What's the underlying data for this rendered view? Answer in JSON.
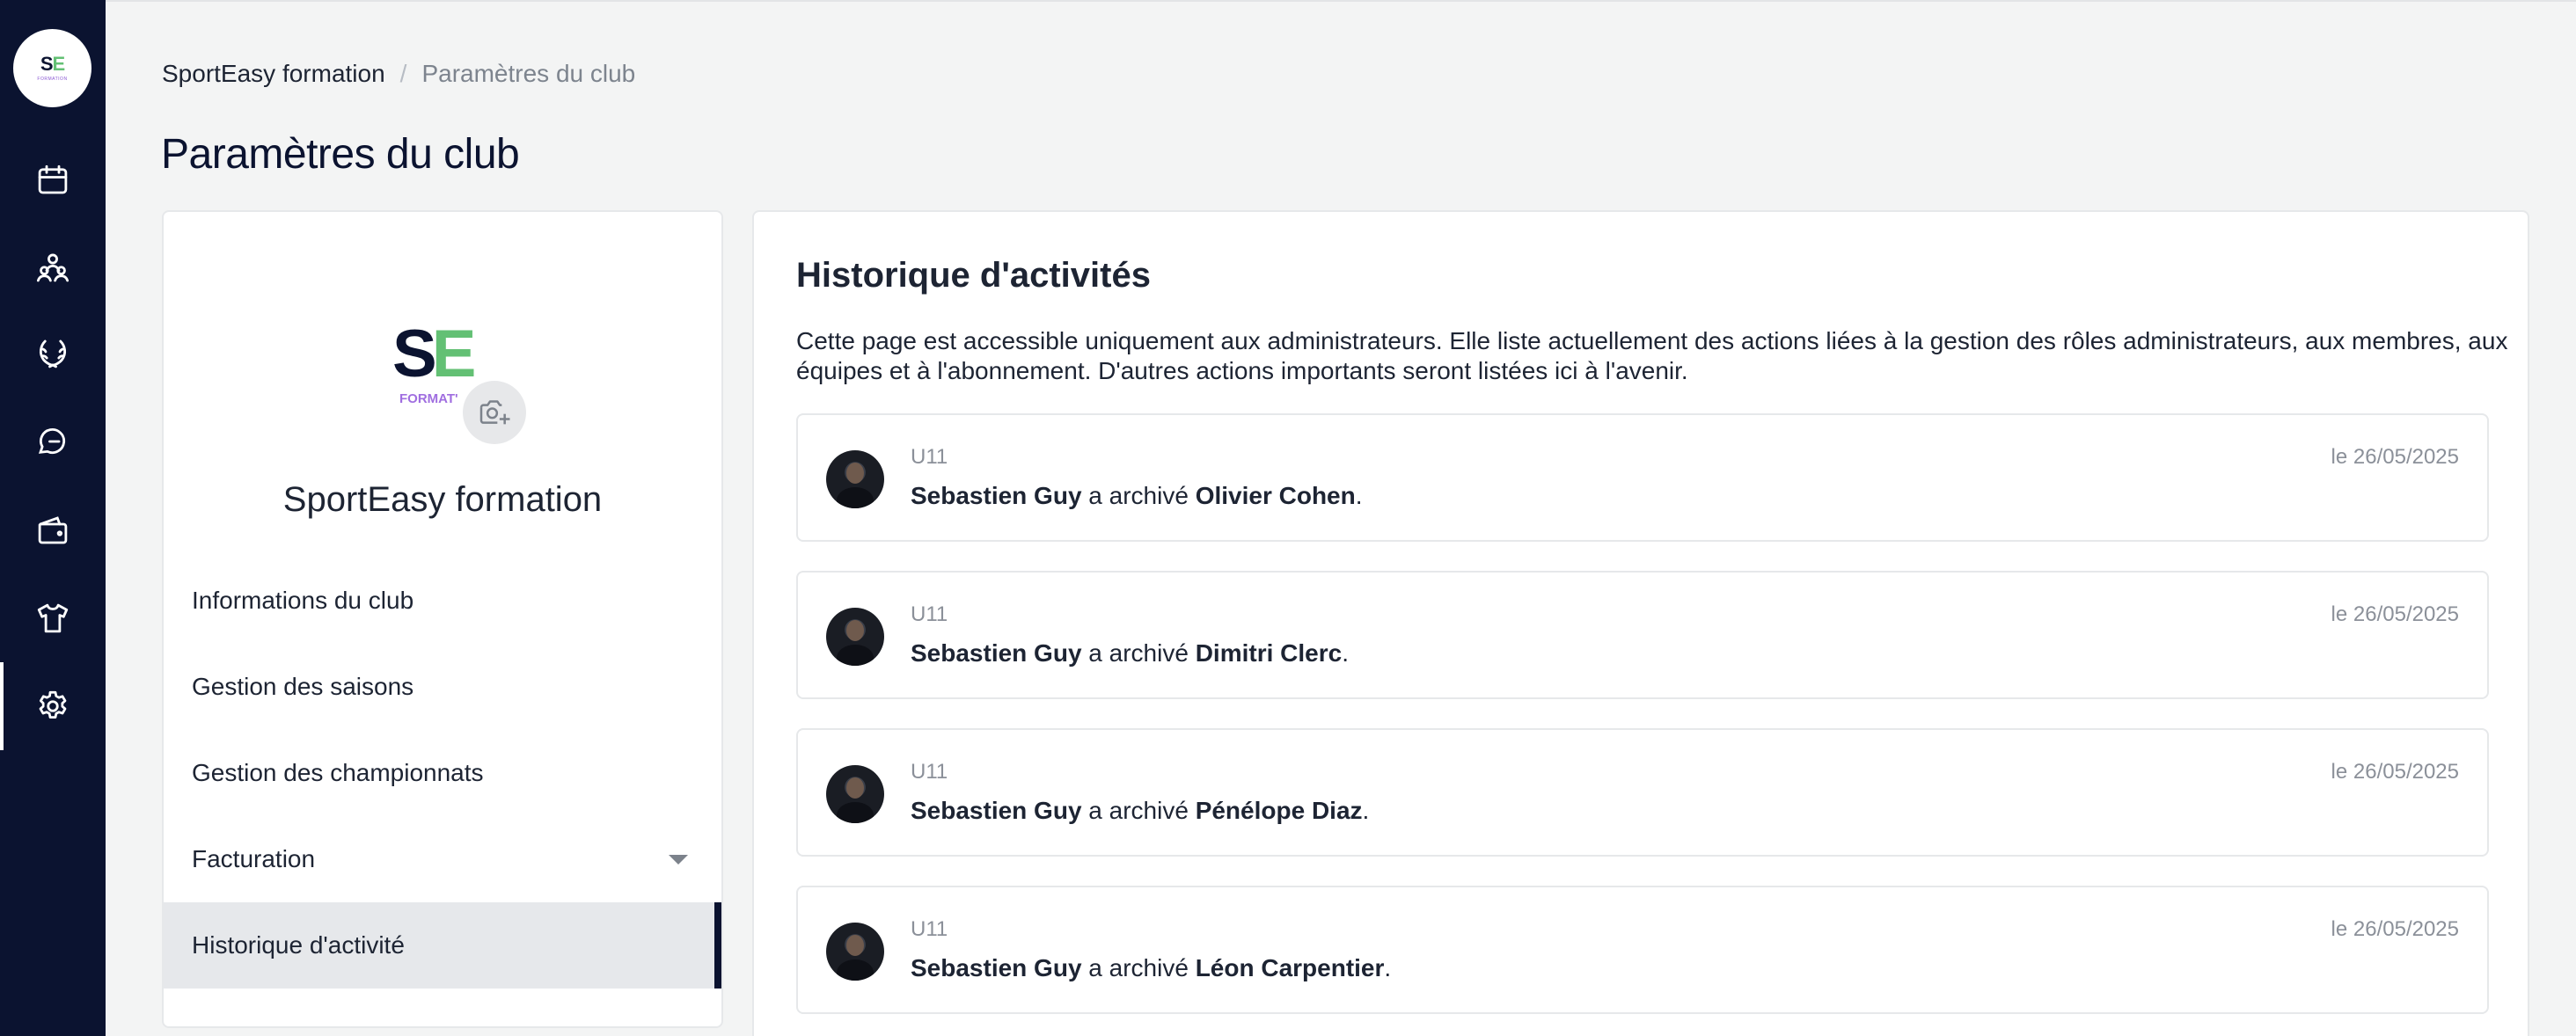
{
  "rail": {
    "logo_text": "SE",
    "logo_sub": "FORMATION",
    "items": [
      {
        "name": "calendar-icon"
      },
      {
        "name": "members-icon"
      },
      {
        "name": "laurel-icon"
      },
      {
        "name": "chat-icon"
      },
      {
        "name": "wallet-icon"
      },
      {
        "name": "jersey-icon"
      },
      {
        "name": "settings-icon",
        "active": true
      }
    ]
  },
  "breadcrumb": {
    "root": "SportEasy formation",
    "separator": "/",
    "current": "Paramètres du club"
  },
  "page_title": "Paramètres du club",
  "club": {
    "logo_text": "SE",
    "logo_sub": "FORMAT'",
    "name": "SportEasy formation"
  },
  "menu": {
    "items": [
      {
        "label": "Informations du club"
      },
      {
        "label": "Gestion des saisons"
      },
      {
        "label": "Gestion des championnats"
      },
      {
        "label": "Facturation",
        "has_dropdown": true
      },
      {
        "label": "Historique d'activité",
        "active": true
      }
    ]
  },
  "history": {
    "title": "Historique d'activités",
    "intro": "Cette page est accessible uniquement aux administrateurs. Elle liste actuellement des actions liées à la gestion des rôles administrateurs, aux membres, aux équipes et à l'abonnement. D'autres actions importants seront listées ici à l'avenir.",
    "entries": [
      {
        "team": "U11",
        "date": "le 26/05/2025",
        "actor": "Sebastien Guy",
        "action": " a archivé ",
        "target": "Olivier Cohen",
        "end": "."
      },
      {
        "team": "U11",
        "date": "le 26/05/2025",
        "actor": "Sebastien Guy",
        "action": " a archivé ",
        "target": "Dimitri Clerc",
        "end": "."
      },
      {
        "team": "U11",
        "date": "le 26/05/2025",
        "actor": "Sebastien Guy",
        "action": " a archivé ",
        "target": "Pénélope Diaz",
        "end": "."
      },
      {
        "team": "U11",
        "date": "le 26/05/2025",
        "actor": "Sebastien Guy",
        "action": " a archivé ",
        "target": "Léon Carpentier",
        "end": "."
      }
    ]
  },
  "colors": {
    "rail_bg": "#0b1330",
    "accent_green": "#63c074",
    "accent_purple": "#a06ee0",
    "page_bg": "#f3f4f4"
  }
}
